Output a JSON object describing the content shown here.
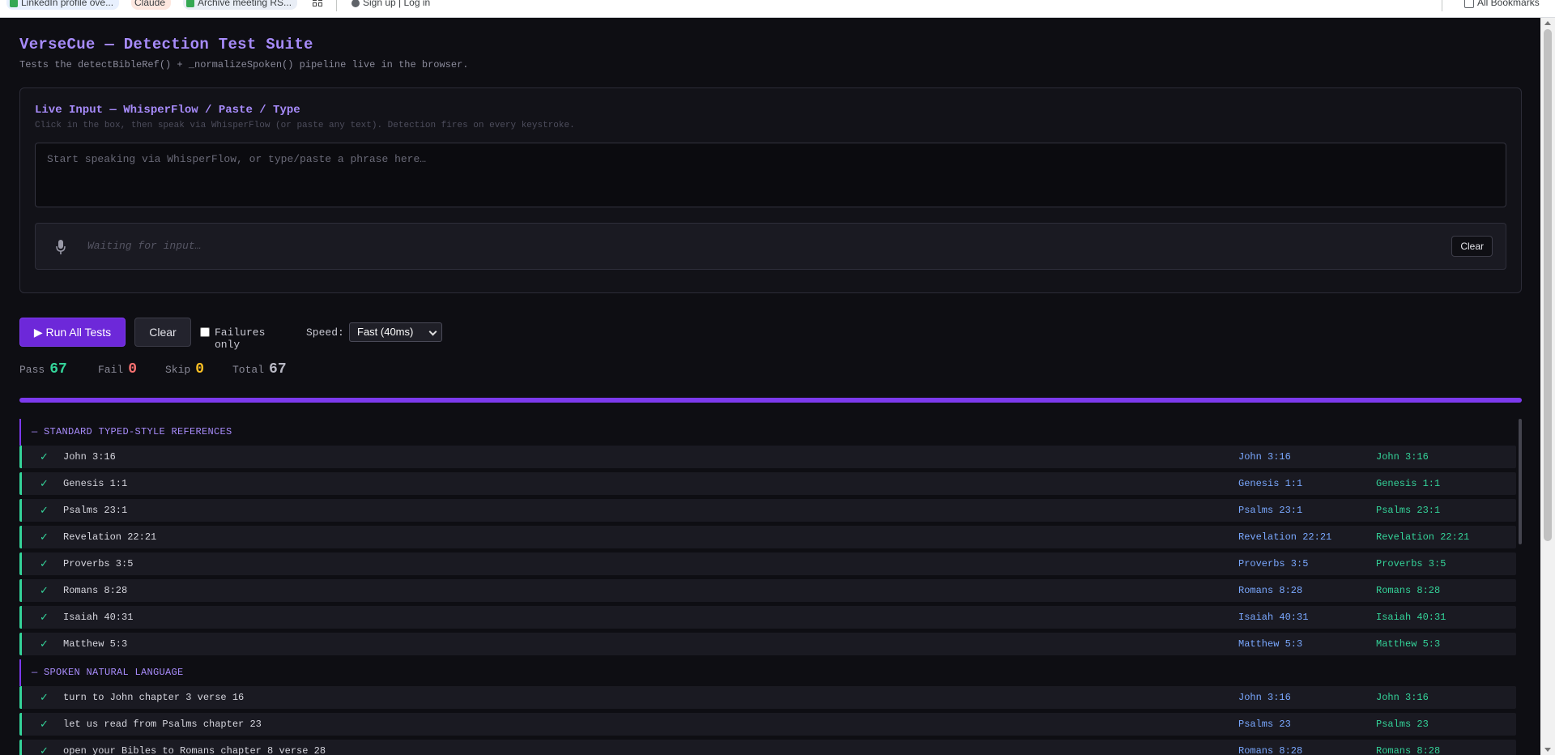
{
  "bookmarks": [
    {
      "label": "LinkedIn profile ove...",
      "color": "#34a853"
    },
    {
      "label": "Claude",
      "color": "#d97757"
    },
    {
      "label": "Archive meeting RS...",
      "color": "#34a853"
    }
  ],
  "bookmarks_extra": {
    "signup_label": "Sign up | Log in",
    "all_bookmarks": "All Bookmarks"
  },
  "header": {
    "title": "VerseCue — Detection Test Suite",
    "subtitle": "Tests the detectBibleRef() + _normalizeSpoken() pipeline live in the browser."
  },
  "live": {
    "title": "Live Input — WhisperFlow / Paste / Type",
    "hint": "Click in the box, then speak via WhisperFlow (or paste any text). Detection fires on every keystroke.",
    "placeholder": "Start speaking via WhisperFlow, or type/paste a phrase here…",
    "status": "Waiting for input…",
    "clear_label": "Clear"
  },
  "controls": {
    "run_label": "▶ Run All Tests",
    "clear_label": "Clear",
    "failures_only_label": "Failures only",
    "failures_only_checked": false,
    "speed_label": "Speed:",
    "speed_value": "Fast (40ms)"
  },
  "stats": {
    "pass_label": "Pass",
    "pass": "67",
    "fail_label": "Fail",
    "fail": "0",
    "skip_label": "Skip",
    "skip": "0",
    "total_label": "Total",
    "total": "67",
    "progress_fraction": 1.0
  },
  "colors": {
    "accent": "#7c3aed",
    "pass": "#34d399",
    "fail": "#f87171",
    "skip": "#fbbf24",
    "total": "#b8b8c4"
  },
  "groups": [
    {
      "title": "— STANDARD TYPED-STYLE REFERENCES",
      "rows": [
        {
          "status": "✓",
          "input": "John 3:16",
          "got": "John 3:16",
          "expected": "John 3:16"
        },
        {
          "status": "✓",
          "input": "Genesis 1:1",
          "got": "Genesis 1:1",
          "expected": "Genesis 1:1"
        },
        {
          "status": "✓",
          "input": "Psalms 23:1",
          "got": "Psalms 23:1",
          "expected": "Psalms 23:1"
        },
        {
          "status": "✓",
          "input": "Revelation 22:21",
          "got": "Revelation 22:21",
          "expected": "Revelation 22:21"
        },
        {
          "status": "✓",
          "input": "Proverbs 3:5",
          "got": "Proverbs 3:5",
          "expected": "Proverbs 3:5"
        },
        {
          "status": "✓",
          "input": "Romans 8:28",
          "got": "Romans 8:28",
          "expected": "Romans 8:28"
        },
        {
          "status": "✓",
          "input": "Isaiah 40:31",
          "got": "Isaiah 40:31",
          "expected": "Isaiah 40:31"
        },
        {
          "status": "✓",
          "input": "Matthew 5:3",
          "got": "Matthew 5:3",
          "expected": "Matthew 5:3"
        }
      ]
    },
    {
      "title": "— SPOKEN NATURAL LANGUAGE",
      "rows": [
        {
          "status": "✓",
          "input": "turn to John chapter 3 verse 16",
          "got": "John 3:16",
          "expected": "John 3:16"
        },
        {
          "status": "✓",
          "input": "let us read from Psalms chapter 23",
          "got": "Psalms 23",
          "expected": "Psalms 23"
        },
        {
          "status": "✓",
          "input": "open your Bibles to Romans chapter 8 verse 28",
          "got": "Romans 8:28",
          "expected": "Romans 8:28"
        }
      ]
    }
  ]
}
